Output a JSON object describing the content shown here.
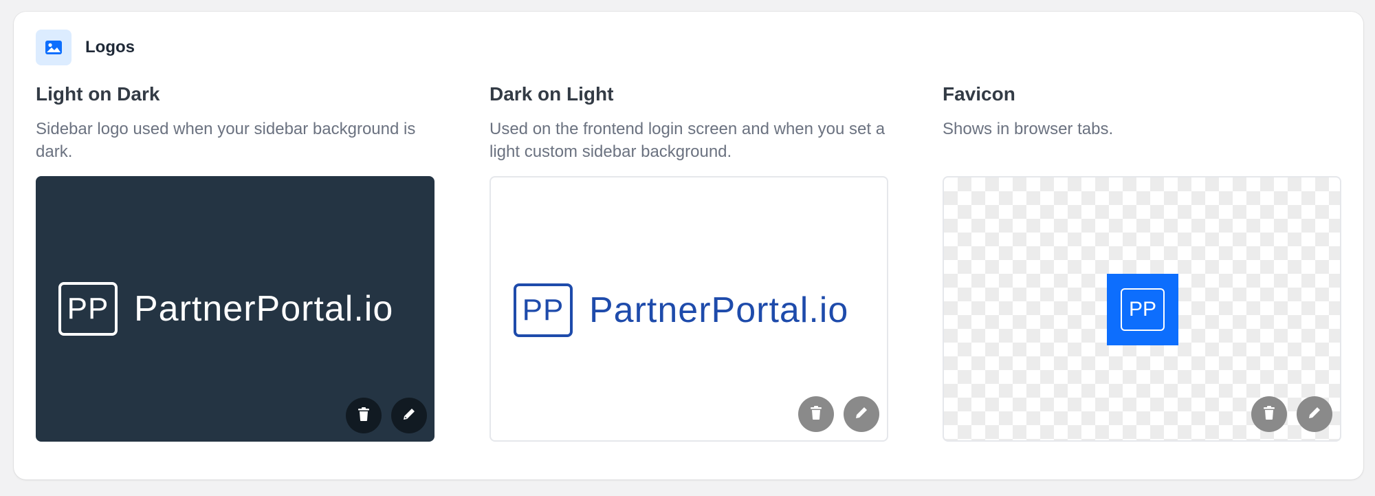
{
  "section": {
    "title": "Logos",
    "icon": "image-icon",
    "icon_color": "#0d6efd"
  },
  "columns": [
    {
      "title": "Light on Dark",
      "description": "Sidebar logo used when your sidebar background is dark.",
      "preview": {
        "mark": "PP",
        "text": "PartnerPortal.io",
        "background": "#243443",
        "color": "#ffffff"
      },
      "actions": {
        "delete": "trash-icon",
        "edit": "pencil-icon"
      }
    },
    {
      "title": "Dark on Light",
      "description": "Used on the frontend login screen and when you set a light custom sidebar background.",
      "preview": {
        "mark": "PP",
        "text": "PartnerPortal.io",
        "background": "#ffffff",
        "color": "#1e4bab"
      },
      "actions": {
        "delete": "trash-icon",
        "edit": "pencil-icon"
      }
    },
    {
      "title": "Favicon",
      "description": "Shows in browser tabs.",
      "preview": {
        "mark": "PP",
        "background": "checkerboard",
        "color": "#0d6efd"
      },
      "actions": {
        "delete": "trash-icon",
        "edit": "pencil-icon"
      }
    }
  ]
}
